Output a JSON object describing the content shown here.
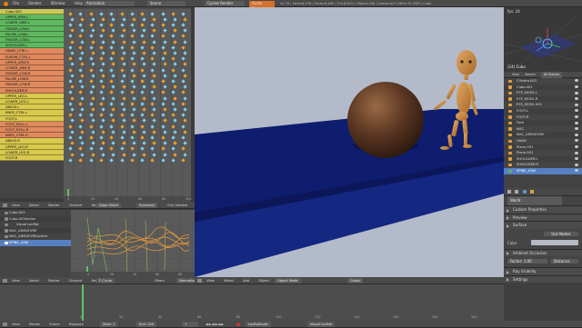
{
  "topbar": {
    "menus": [
      "File",
      "Render",
      "Window",
      "Help"
    ],
    "screen": "Animation",
    "scene": "Scene",
    "engine": "Cycles Render",
    "playback": "Audio Player",
    "stats": "v2.78 | Verts:8,578 | Faces:8,460 | Tris:8,622 | Objects:0/6 | Lamps:0/0 | Mem:31.28M | Cubo"
  },
  "channels": [
    {
      "name": "Cubo.003",
      "color": "#c9c957"
    },
    {
      "name": "UPPER_ARM.L",
      "color": "#5fb85f"
    },
    {
      "name": "LOWER_ARM.L",
      "color": "#5fb85f"
    },
    {
      "name": "FINGER_LOW.L",
      "color": "#5fb85f"
    },
    {
      "name": "PALME_LOW.L",
      "color": "#5fb85f"
    },
    {
      "name": "FINGER_LOW.L",
      "color": "#5fb85f"
    },
    {
      "name": "SHOULDER.L",
      "color": "#5fb85f"
    },
    {
      "name": "HAND_CTRL.L",
      "color": "#e08a5e"
    },
    {
      "name": "ELBOW_CTRL.L",
      "color": "#e08a5e"
    },
    {
      "name": "UPPER_ARM.R",
      "color": "#e08a5e"
    },
    {
      "name": "LOWER_ARM.R",
      "color": "#e08a5e"
    },
    {
      "name": "FINGER_LOW.R",
      "color": "#e08a5e"
    },
    {
      "name": "PALME_LOW.R",
      "color": "#e08a5e"
    },
    {
      "name": "FINGER_LOW.R",
      "color": "#e08a5e"
    },
    {
      "name": "SHOULDER.R",
      "color": "#e08a5e"
    },
    {
      "name": "UPPER_LEG.L",
      "color": "#d9c94d"
    },
    {
      "name": "LOWER_LEG.L",
      "color": "#d9c94d"
    },
    {
      "name": "ANKLE.L",
      "color": "#d9c94d"
    },
    {
      "name": "KNEE_CTRL.L",
      "color": "#d9c94d"
    },
    {
      "name": "FOOT.L",
      "color": "#d9c94d"
    },
    {
      "name": "FOOT_ROLL.L",
      "color": "#e08a5e"
    },
    {
      "name": "FOOT_ROLL.R",
      "color": "#e08a5e"
    },
    {
      "name": "KNEE_CTRL.R",
      "color": "#e08a5e"
    },
    {
      "name": "ANKLE.R",
      "color": "#d9c94d"
    },
    {
      "name": "UPPER_LEG.R",
      "color": "#d9c94d"
    },
    {
      "name": "LOWER_LEG.R",
      "color": "#d9c94d"
    },
    {
      "name": "FOOT.R",
      "color": "#d9c94d"
    }
  ],
  "dopesheet_ruler": [
    "0",
    "20",
    "40",
    "60",
    "80",
    "100"
  ],
  "dopesheet_header": {
    "menus": [
      "View",
      "Select",
      "Marker",
      "Channel",
      "Key"
    ],
    "mode": "Dope Sheet",
    "summary": "Summary",
    "only_selected": "Only Selected"
  },
  "graph_channels": [
    {
      "name": "Cubo.003",
      "kind": "obj"
    },
    {
      "name": "Cubo.003Action",
      "kind": "obj"
    },
    {
      "name": "Visual LocRot",
      "kind": "sub"
    },
    {
      "name": "MAC_ARMATURE",
      "kind": "obj"
    },
    {
      "name": "MAC_ARMATUREAction",
      "kind": "obj"
    },
    {
      "name": "SPINE_LOW",
      "kind": "sel"
    }
  ],
  "graph_header": {
    "menus": [
      "View",
      "Select",
      "Marker",
      "Channel",
      "Key"
    ],
    "mode": "F-Curve",
    "filters": "Filters",
    "pivot": "Normalize"
  },
  "viewport_header": {
    "menus": [
      "View",
      "Select",
      "Add",
      "Object"
    ],
    "mode": "Object Mode",
    "orientation": "Global"
  },
  "timeline": {
    "menus": [
      "View",
      "Marker",
      "Frame",
      "Playback"
    ],
    "start_label": "Start:",
    "start": "1",
    "end_label": "End:",
    "end": "250",
    "current": "1",
    "keying": "LocRotScale",
    "keyset": "Visual LocRot",
    "ruler": [
      "0",
      "20",
      "40",
      "60",
      "80",
      "100",
      "120",
      "140",
      "160",
      "180",
      "200",
      "220",
      "240"
    ]
  },
  "outliner_header": {
    "menus": [
      "View",
      "Search",
      "All Scenes"
    ]
  },
  "outliner": [
    {
      "name": "Cilindro.001",
      "color": "#e0a040",
      "sel": false
    },
    {
      "name": "Cubo.001",
      "color": "#e0a040",
      "sel": false
    },
    {
      "name": "EYE_MODL.L",
      "color": "#e0a040",
      "sel": false
    },
    {
      "name": "EYE_MODL.R",
      "color": "#e0a040",
      "sel": false
    },
    {
      "name": "EYE_MODL.001",
      "color": "#e0a040",
      "sel": false
    },
    {
      "name": "FOOT.L",
      "color": "#e0a040",
      "sel": false
    },
    {
      "name": "FOOT.R",
      "color": "#e0a040",
      "sel": false
    },
    {
      "name": "Foot",
      "color": "#e0a040",
      "sel": false
    },
    {
      "name": "MAC",
      "color": "#e0a040",
      "sel": false
    },
    {
      "name": "MAC_ARMATURE",
      "color": "#e0a040",
      "sel": false
    },
    {
      "name": "HAND",
      "color": "#e0a040",
      "sel": false
    },
    {
      "name": "Plane.001",
      "color": "#e0a040",
      "sel": false
    },
    {
      "name": "Plane.002",
      "color": "#e0a040",
      "sel": false
    },
    {
      "name": "SHOULDER.L",
      "color": "#e0a040",
      "sel": false
    },
    {
      "name": "SHOULDER.R",
      "color": "#e0a040",
      "sel": false
    },
    {
      "name": "SPINE_LOW",
      "color": "#5fb85f",
      "sel": true
    }
  ],
  "props": {
    "world_label": "World",
    "sections": [
      "Custom Properties",
      "Preview",
      "Surface"
    ],
    "use_nodes": "Use Nodes",
    "color_label": "Color",
    "ao_label": "Ambient Occlusion",
    "factor_label": "Factor:",
    "factor": "1.00",
    "distance": "Distance",
    "more": [
      "Ray Visibility",
      "Settings"
    ]
  },
  "mini_view": {
    "label": "(24) Cubo",
    "title": "fps: 24"
  }
}
